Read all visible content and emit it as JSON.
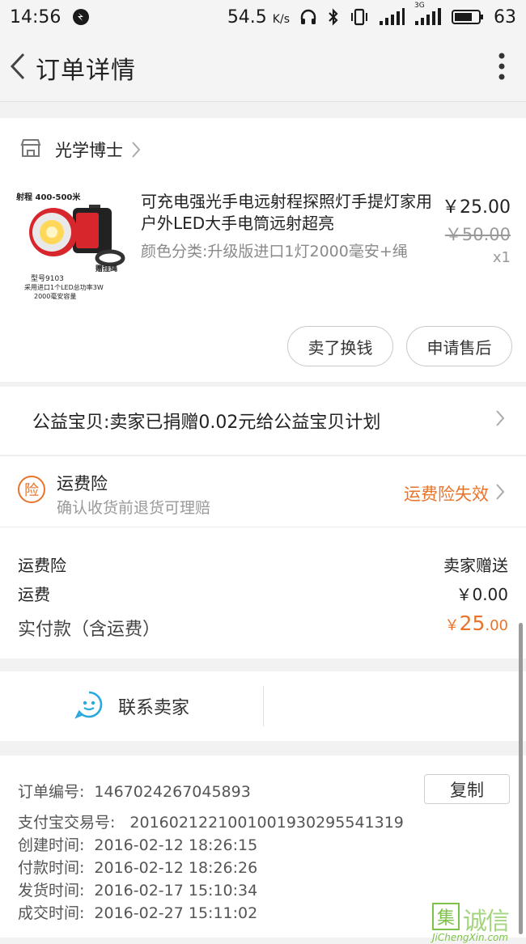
{
  "status_bar": {
    "time": "14:56",
    "speed_value": "54.5",
    "speed_unit": "K/s",
    "network_label": "3G",
    "battery": "63"
  },
  "nav": {
    "title": "订单详情"
  },
  "shop": {
    "name": "光学博士"
  },
  "product": {
    "title": "可充电强光手电远射程探照灯手提灯家用户外LED大手电筒远射超亮",
    "spec": "颜色分类:升级版进口1灯2000毫安+绳",
    "price_now": "￥25.00",
    "price_old": "￥50.00",
    "qty": "x1",
    "image_caption_top": "射程 400-500米",
    "image_caption_tag": "赠挂绳",
    "image_caption_model": "型号9103",
    "image_caption_line1": "采用进口1个LED总功率3W",
    "image_caption_line2": "2000毫安容量",
    "sell_button": "卖了换钱",
    "after_sale_button": "申请售后"
  },
  "charity": {
    "text": "公益宝贝:卖家已捐赠0.02元给公益宝贝计划"
  },
  "insurance": {
    "icon_char": "险",
    "title": "运费险",
    "subtitle": "确认收货前退货可理赔",
    "status": "运费险失效"
  },
  "fees": {
    "insurance_label": "运费险",
    "insurance_value": "卖家赠送",
    "shipping_label": "运费",
    "shipping_value": "￥0.00",
    "total_label": "实付款（含运费）",
    "total_currency": "￥",
    "total_int": "25",
    "total_dec": ".00"
  },
  "contact": {
    "label": "联系卖家"
  },
  "order_info": {
    "order_no_label": "订单编号:",
    "order_no": "1467024267045893",
    "copy_button": "复制",
    "alipay_label": "支付宝交易号:",
    "alipay_no": "2016021221001001930295541319",
    "created_label": "创建时间:",
    "created": "2016-02-12 18:26:15",
    "paid_label": "付款时间:",
    "paid": "2016-02-12 18:26:26",
    "shipped_label": "发货时间:",
    "shipped": "2016-02-17 15:10:34",
    "completed_label": "成交时间:",
    "completed": "2016-02-27 15:11:02"
  },
  "watermark": {
    "box_char": "集",
    "text": "诚信",
    "url": "JiChengXin.com"
  },
  "colors": {
    "accent_orange": "#e8742a",
    "contact_blue": "#2aa8e0",
    "product_red": "#d8262d"
  }
}
